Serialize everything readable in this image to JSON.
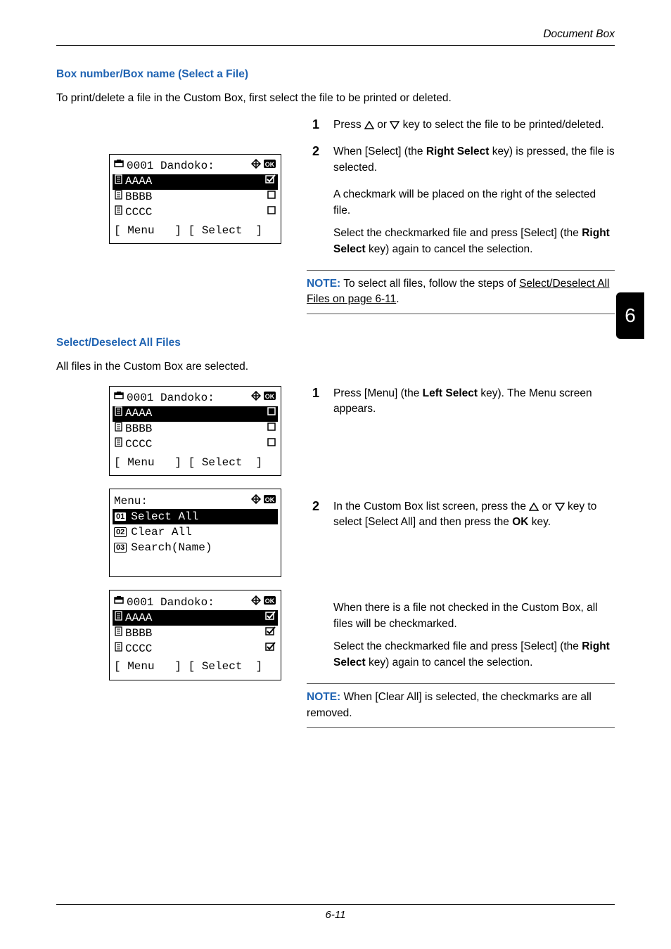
{
  "header_title": "Document Box",
  "chapter_tab": "6",
  "footer": "6-11",
  "sec1": {
    "heading": "Box number/Box name (Select a File)",
    "intro": "To print/delete a file in the Custom Box, first select the file to be printed or deleted.",
    "lcd": {
      "title": "0001 Dandoko:",
      "rows": [
        {
          "name": "AAAA",
          "mark": "chk_ok"
        },
        {
          "name": "BBBB",
          "mark": "box"
        },
        {
          "name": "CCCC",
          "mark": "box"
        }
      ],
      "soft_left": "Menu",
      "soft_right": "Select"
    },
    "step1": {
      "num": "1",
      "pre": "Press ",
      "post": " key to select the file to be printed/deleted."
    },
    "step2": {
      "num": "2",
      "a": "When [Select] (the ",
      "b": "Right Select",
      "c": " key) is pressed, the file is selected."
    },
    "p1": "A checkmark will be placed on the right of the selected file.",
    "p2a": "Select the checkmarked file and press [Select] (the ",
    "p2b": "Right Select",
    "p2c": " key) again to cancel the selection.",
    "note": {
      "label": "NOTE:",
      "a": " To select all files, follow the steps of ",
      "link": "Select/Deselect All Files on page 6-11",
      "b": "."
    }
  },
  "sec2": {
    "heading": "Select/Deselect All Files",
    "intro": "All files in the Custom Box are selected.",
    "lcdA": {
      "title": "0001 Dandoko:",
      "rows": [
        {
          "name": "AAAA",
          "mark": "box"
        },
        {
          "name": "BBBB",
          "mark": "box"
        },
        {
          "name": "CCCC",
          "mark": "box"
        }
      ],
      "soft_left": "Menu",
      "soft_right": "Select"
    },
    "lcdMenu": {
      "title": "Menu:",
      "items": [
        {
          "num": "01",
          "label": "Select All"
        },
        {
          "num": "02",
          "label": "Clear All"
        },
        {
          "num": "03",
          "label": "Search(Name)"
        }
      ]
    },
    "lcdB": {
      "title": "0001 Dandoko:",
      "rows": [
        {
          "name": "AAAA",
          "mark": "chk_ok"
        },
        {
          "name": "BBBB",
          "mark": "chk_ok"
        },
        {
          "name": "CCCC",
          "mark": "chk_ok"
        }
      ],
      "soft_left": "Menu",
      "soft_right": "Select"
    },
    "step1": {
      "num": "1",
      "a": "Press [Menu] (the ",
      "b": "Left Select",
      "c": " key). The Menu screen appears."
    },
    "step2": {
      "num": "2",
      "a": "In the Custom Box list screen, press the ",
      "b": " key to select [Select All] and then press the ",
      "ok": "OK",
      "c": " key."
    },
    "p1": "When there is a file not checked in the Custom Box, all files will be checkmarked.",
    "p2a": "Select the checkmarked file and press [Select] (the ",
    "p2b": "Right Select",
    "p2c": " key) again to cancel the selection.",
    "note": {
      "label": "NOTE:",
      "a": " When [Clear All] is selected, the checkmarks are all removed."
    }
  }
}
